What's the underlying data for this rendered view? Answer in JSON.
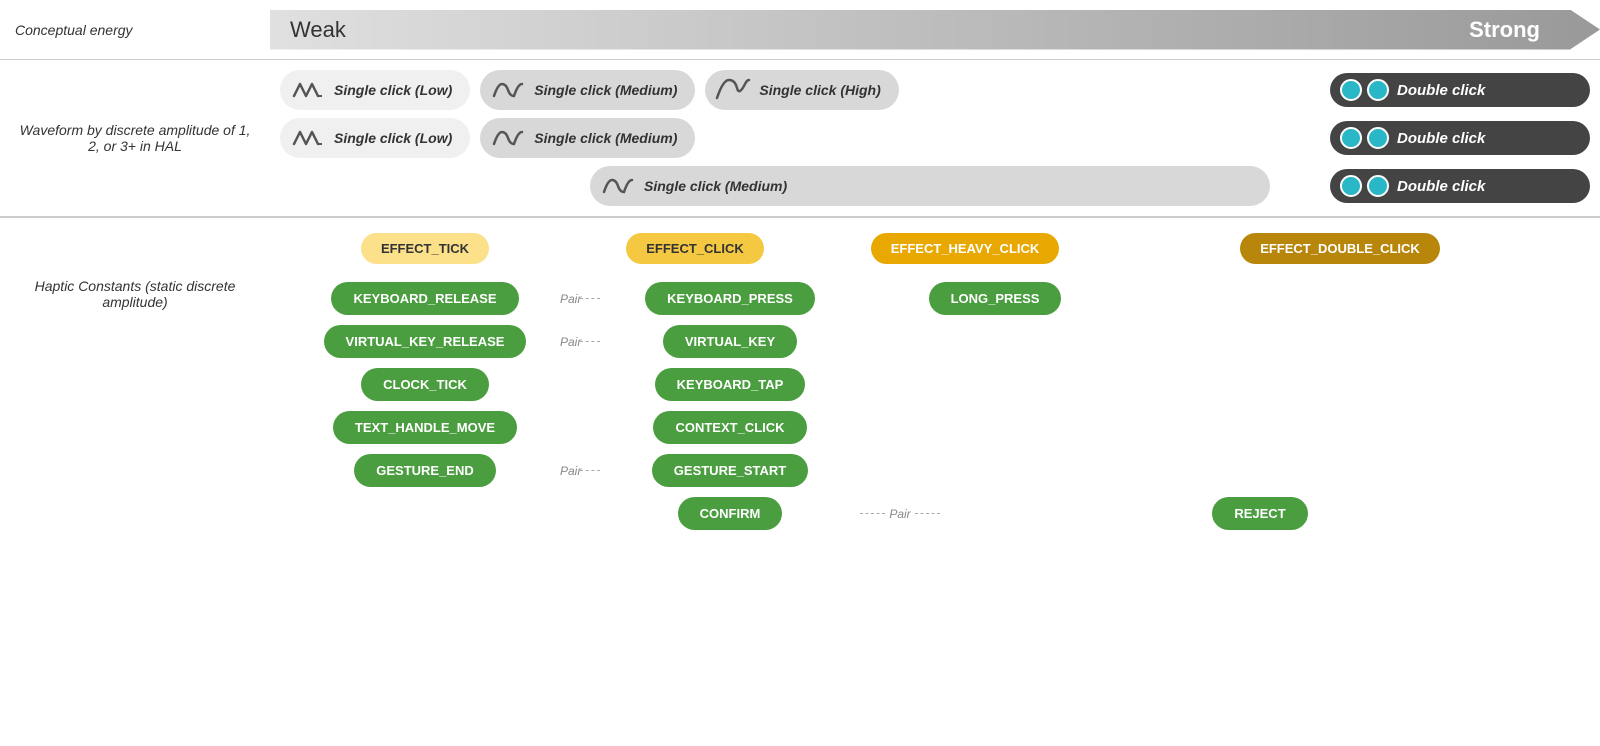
{
  "header": {
    "label": "Conceptual energy",
    "weak": "Weak",
    "strong": "Strong"
  },
  "waveform_section": {
    "label": "Waveform by discrete amplitude of 1, 2, or 3+ in HAL",
    "row1": {
      "pill1": {
        "label": "Single click (Low)",
        "type": "low"
      },
      "pill2": {
        "label": "Single click (Medium)",
        "type": "medium"
      },
      "pill3": {
        "label": "Single click (High)",
        "type": "high"
      },
      "pill4": {
        "label": "Double click",
        "type": "double"
      }
    },
    "row2": {
      "pill1": {
        "label": "Single click (Low)",
        "type": "low"
      },
      "pill2": {
        "label": "Single click (Medium)",
        "type": "medium"
      },
      "pill3": {
        "label": "Double click",
        "type": "double"
      }
    },
    "row3": {
      "pill1": {
        "label": "Single click (Medium)",
        "type": "medium"
      },
      "pill2": {
        "label": "Double click",
        "type": "double"
      }
    }
  },
  "haptic_section": {
    "label": "Haptic Constants (static discrete amplitude)",
    "effects": [
      {
        "id": "effect-tick",
        "label": "EFFECT_TICK",
        "style": "tick"
      },
      {
        "id": "effect-click",
        "label": "EFFECT_CLICK",
        "style": "click"
      },
      {
        "id": "effect-heavy",
        "label": "EFFECT_HEAVY_CLICK",
        "style": "heavy"
      },
      {
        "id": "effect-double",
        "label": "EFFECT_DOUBLE_CLICK",
        "style": "double"
      }
    ],
    "col1_pills": [
      {
        "label": "KEYBOARD_RELEASE",
        "pair": true
      },
      {
        "label": "VIRTUAL_KEY_RELEASE",
        "pair": true
      },
      {
        "label": "CLOCK_TICK"
      },
      {
        "label": "TEXT_HANDLE_MOVE"
      },
      {
        "label": "GESTURE_END",
        "pair": true
      }
    ],
    "col2_pills": [
      {
        "label": "KEYBOARD_PRESS"
      },
      {
        "label": "VIRTUAL_KEY"
      },
      {
        "label": "KEYBOARD_TAP"
      },
      {
        "label": "CONTEXT_CLICK"
      },
      {
        "label": "GESTURE_START"
      },
      {
        "label": "CONFIRM",
        "pair": true
      }
    ],
    "col3_pills": [
      {
        "label": "LONG_PRESS"
      }
    ],
    "col4_pills": [
      {
        "label": "REJECT"
      }
    ],
    "pair_label": "Pair"
  }
}
